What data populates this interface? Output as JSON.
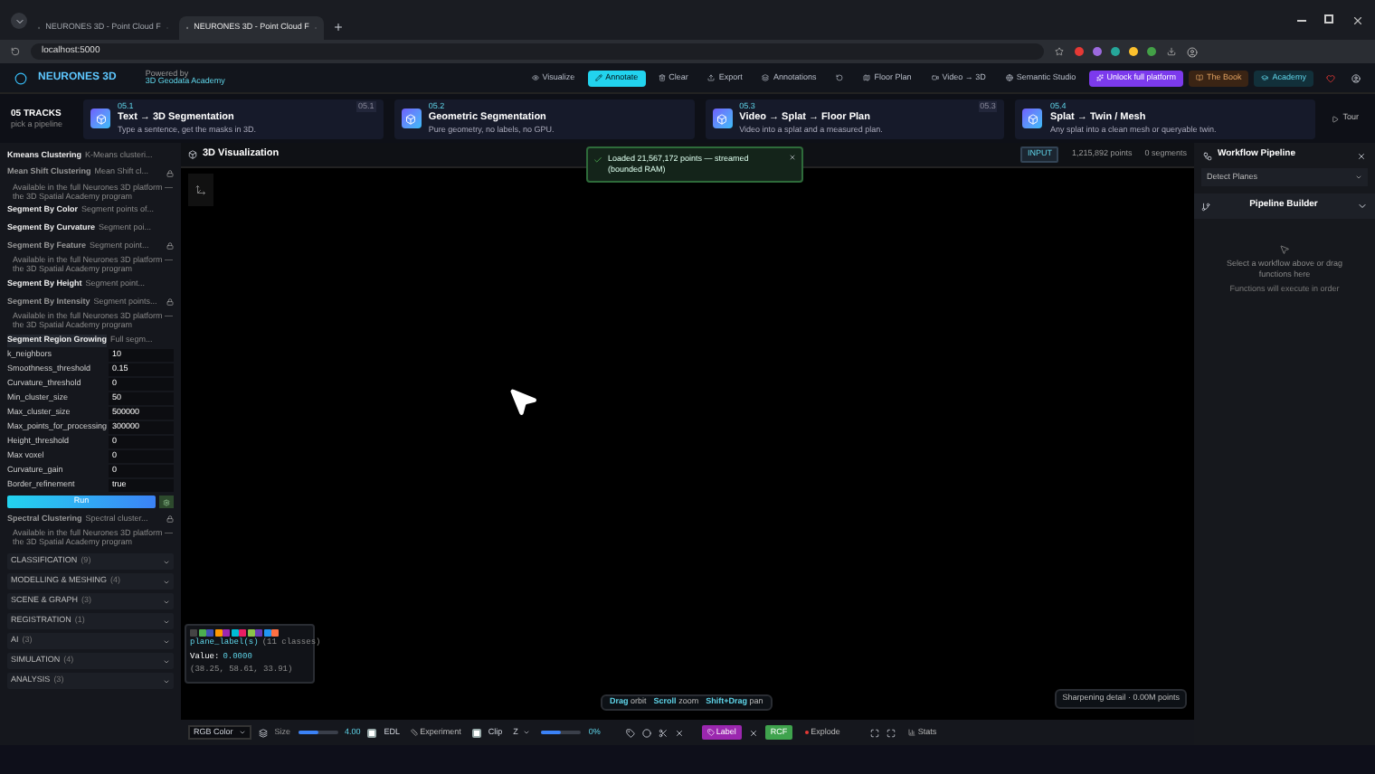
{
  "browser": {
    "tabs": [
      {
        "title": "NEURONES 3D - Point Cloud F",
        "selected": false
      },
      {
        "title": "NEURONES 3D - Point Cloud F",
        "selected": true
      }
    ],
    "address": "localhost:5000"
  },
  "header": {
    "logo": "NEURONES 3D",
    "powered_by": "Powered by",
    "academy": "3D Geodata Academy",
    "nav": [
      {
        "label": "Visualize",
        "kind": "plain",
        "selected": false
      },
      {
        "label": "Annotate",
        "kind": "plain",
        "selected": true
      },
      {
        "label": "Clear",
        "kind": "plain",
        "selected": false
      },
      {
        "label": "Export",
        "kind": "plain",
        "selected": false
      },
      {
        "label": "Annotations",
        "kind": "plain",
        "selected": false
      },
      {
        "kind": "reset",
        "selected": false
      },
      {
        "label": "Floor Plan",
        "kind": "plain",
        "selected": false
      },
      {
        "label": "Video → 3D",
        "kind": "plain",
        "selected": false
      },
      {
        "label": "Semantic Studio",
        "kind": "plain",
        "selected": false
      },
      {
        "label": "Unlock full platform",
        "kind": "promo",
        "selected": false
      },
      {
        "label": "The Book",
        "kind": "book",
        "selected": false
      },
      {
        "label": "Academy",
        "kind": "academy",
        "selected": false
      }
    ]
  },
  "tracks": {
    "count": "05 TRACKS",
    "subtitle": "pick a pipeline",
    "items": [
      {
        "tag": "05.1",
        "title": "Text → 3D Segmentation",
        "desc": "Type a sentence, get the masks in 3D.",
        "badge": "05.1"
      },
      {
        "tag": "05.2",
        "title": "Geometric Segmentation",
        "desc": "Pure geometry, no labels, no GPU."
      },
      {
        "tag": "05.3",
        "title": "Video → Splat → Floor Plan",
        "desc": "Video into a splat and a measured plan.",
        "badge": "05.3"
      },
      {
        "tag": "05.4",
        "title": "Splat → Twin / Mesh",
        "desc": "Any splat into a clean mesh or queryable twin."
      }
    ],
    "tour": "Tour"
  },
  "toast": {
    "text": "Loaded 21,567,172 points — streamed (bounded RAM)"
  },
  "functions": [
    {
      "name": "Kmeans Clustering",
      "desc": "K-Means clusteri...",
      "locked": false
    },
    {
      "name": "Mean Shift Clustering",
      "desc": "Mean Shift cl...",
      "locked": true,
      "note": "Available in the full Neurones 3D platform — the 3D Spatial Academy program"
    },
    {
      "name": "Segment By Color",
      "desc": "Segment points of...",
      "locked": false
    },
    {
      "name": "Segment By Curvature",
      "desc": "Segment poi...",
      "locked": false
    },
    {
      "name": "Segment By Feature",
      "desc": "Segment point...",
      "locked": true,
      "note": "Available in the full Neurones 3D platform — the 3D Spatial Academy program"
    },
    {
      "name": "Segment By Height",
      "desc": "Segment point...",
      "locked": false
    },
    {
      "name": "Segment By Intensity",
      "desc": "Segment points...",
      "locked": true,
      "note": "Available in the full Neurones 3D platform — the 3D Spatial Academy program"
    },
    {
      "name": "Segment Region Growing",
      "desc": "Full segm...",
      "locked": false,
      "expanded": true,
      "params": [
        {
          "name": "k_neighbors",
          "value": "10"
        },
        {
          "name": "Smoothness_threshold",
          "value": "0.15"
        },
        {
          "name": "Curvature_threshold",
          "value": "0"
        },
        {
          "name": "Min_cluster_size",
          "value": "50"
        },
        {
          "name": "Max_cluster_size",
          "value": "500000"
        },
        {
          "name": "Max_points_for_processing",
          "value": "300000"
        },
        {
          "name": "Height_threshold",
          "value": "0"
        },
        {
          "name": "Max voxel",
          "value": "0"
        },
        {
          "name": "Curvature_gain",
          "value": "0"
        },
        {
          "name": "Border_refinement",
          "value": "true"
        }
      ],
      "run": "Run"
    },
    {
      "name": "Spectral Clustering",
      "desc": "Spectral cluster...",
      "locked": true,
      "note": "Available in the full Neurones 3D platform — the 3D Spatial Academy program"
    }
  ],
  "categories": [
    {
      "name": "CLASSIFICATION",
      "count": "(9)",
      "expanded": false
    },
    {
      "name": "MODELLING & MESHING",
      "count": "(4)",
      "expanded": false
    },
    {
      "name": "SCENE & GRAPH",
      "count": "(3)",
      "expanded": false
    },
    {
      "name": "REGISTRATION",
      "count": "(1)",
      "expanded": false
    },
    {
      "name": "AI",
      "count": "(3)",
      "expanded": false
    },
    {
      "name": "SIMULATION",
      "count": "(4)",
      "expanded": false
    },
    {
      "name": "ANALYSIS",
      "count": "(3)",
      "expanded": false
    }
  ],
  "viz": {
    "title": "3D Visualization",
    "mode": "INPUT",
    "points": "1,215,892 points",
    "segments": "0 segments",
    "legend": {
      "swatches": [
        {
          "color": "#444444"
        },
        {
          "color": "#4caf50"
        },
        {
          "color": "#3f51b5"
        },
        {
          "color": "#ff9800"
        },
        {
          "color": "#9c27b0"
        },
        {
          "color": "#00bcd4"
        },
        {
          "color": "#e91e63"
        },
        {
          "color": "#8bc34a"
        },
        {
          "color": "#673ab7"
        },
        {
          "color": "#2196f3"
        },
        {
          "color": "#ff7043"
        }
      ],
      "field": "plane_label(s)",
      "classes": "(11 classes)",
      "value_label": "Value:",
      "value": "0.0000",
      "coords": "(38.25, 58.61, 33.91)"
    },
    "hints": [
      {
        "key": "Drag",
        "action": "orbit"
      },
      {
        "key": "Scroll",
        "action": "zoom"
      },
      {
        "key": "Shift+Drag",
        "action": "pan"
      }
    ],
    "status": "Sharpening detail · 0.00M points"
  },
  "toolbar": {
    "color_mode": "RGB Color",
    "size_label": "Size",
    "size": {
      "level": 0.5
    },
    "size_value": "4.00",
    "edl": {
      "label": "EDL",
      "checked": false
    },
    "experiment": "Experiment",
    "clip": {
      "label": "Clip",
      "checked": false
    },
    "axis": "Z",
    "clip_slider": {
      "level": 0.5
    },
    "clip_value": "0%",
    "label_button": "Label",
    "rcf": "RCF",
    "explode": "Explode",
    "stats": "Stats"
  },
  "workflow": {
    "title": "Workflow Pipeline",
    "select": "Detect Planes",
    "builder": "Pipeline Builder",
    "empty": "Select a workflow above or drag functions here",
    "hint": "Functions will execute in order"
  }
}
